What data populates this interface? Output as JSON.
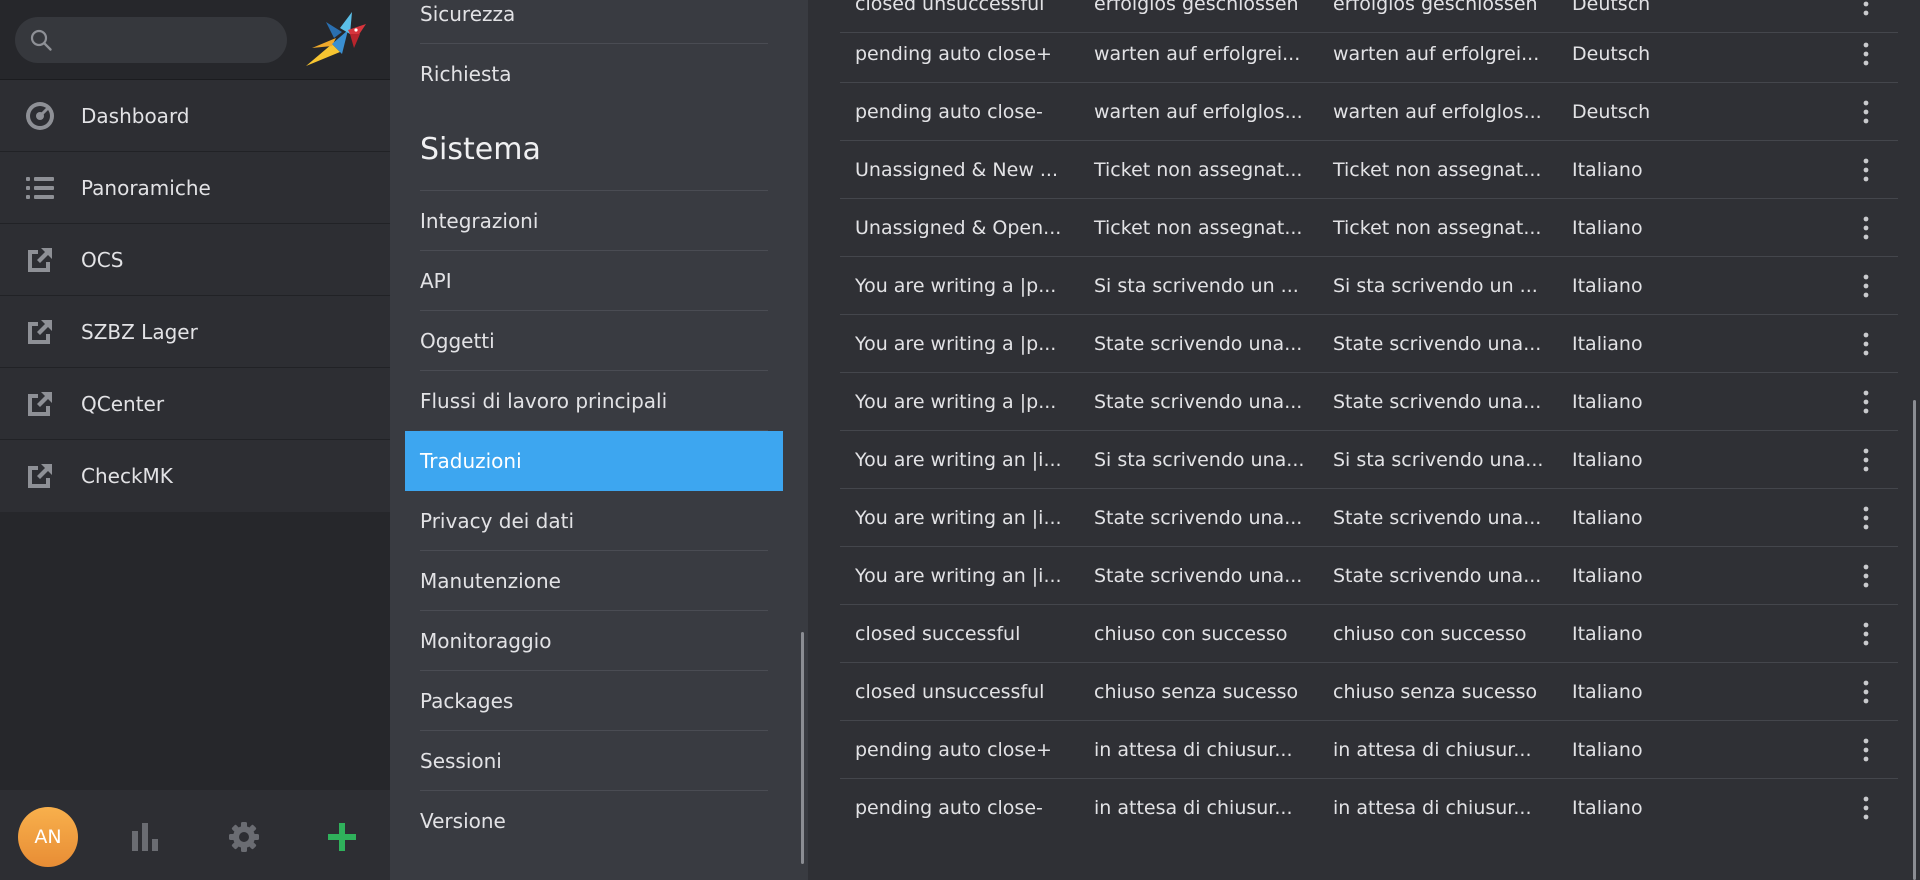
{
  "search": {
    "placeholder": ""
  },
  "nav": {
    "items": [
      {
        "label": "Dashboard",
        "icon": "dashboard-gauge-icon"
      },
      {
        "label": "Panoramiche",
        "icon": "list-icon"
      },
      {
        "label": "OCS",
        "icon": "external-link-icon"
      },
      {
        "label": "SZBZ Lager",
        "icon": "external-link-icon"
      },
      {
        "label": "QCenter",
        "icon": "external-link-icon"
      },
      {
        "label": "CheckMK",
        "icon": "external-link-icon"
      }
    ],
    "footer": {
      "avatar_initials": "AN",
      "stats_icon": "bar-chart-icon",
      "settings_icon": "gear-icon",
      "new_icon": "plus-icon",
      "new_color": "#2fb15b"
    }
  },
  "settings_menu": {
    "top_items": [
      "Sicurezza",
      "Richiesta"
    ],
    "section_title": "Sistema",
    "items": [
      {
        "label": "Integrazioni",
        "active": false
      },
      {
        "label": "API",
        "active": false
      },
      {
        "label": "Oggetti",
        "active": false
      },
      {
        "label": "Flussi di lavoro principali",
        "active": false
      },
      {
        "label": "Traduzioni",
        "active": true
      },
      {
        "label": "Privacy dei dati",
        "active": false
      },
      {
        "label": "Manutenzione",
        "active": false
      },
      {
        "label": "Monitoraggio",
        "active": false
      },
      {
        "label": "Packages",
        "active": false
      },
      {
        "label": "Sessioni",
        "active": false
      },
      {
        "label": "Versione",
        "active": false
      }
    ],
    "accent_color": "#3da6f0"
  },
  "translations": {
    "rows": [
      [
        "closed unsuccessful",
        "erfolglos geschlossen",
        "erfolglos geschlossen",
        "Deutsch"
      ],
      [
        "pending auto close+",
        "warten auf erfolgrei...",
        "warten auf erfolgrei...",
        "Deutsch"
      ],
      [
        "pending auto close-",
        "warten auf erfolglos...",
        "warten auf erfolglos...",
        "Deutsch"
      ],
      [
        "Unassigned & New ...",
        "Ticket non assegnat...",
        "Ticket non assegnat...",
        "Italiano"
      ],
      [
        "Unassigned & Open...",
        "Ticket non assegnat...",
        "Ticket non assegnat...",
        "Italiano"
      ],
      [
        "You are writing a |p...",
        "Si sta scrivendo un ...",
        "Si sta scrivendo un ...",
        "Italiano"
      ],
      [
        "You are writing a |p...",
        "State scrivendo una...",
        "State scrivendo una...",
        "Italiano"
      ],
      [
        "You are writing a |p...",
        "State scrivendo una...",
        "State scrivendo una...",
        "Italiano"
      ],
      [
        "You are writing an |i...",
        "Si sta scrivendo una...",
        "Si sta scrivendo una...",
        "Italiano"
      ],
      [
        "You are writing an |i...",
        "State scrivendo una...",
        "State scrivendo una...",
        "Italiano"
      ],
      [
        "You are writing an |i...",
        "State scrivendo una...",
        "State scrivendo una...",
        "Italiano"
      ],
      [
        "closed successful",
        "chiuso con successo",
        "chiuso con successo",
        "Italiano"
      ],
      [
        "closed unsuccessful",
        "chiuso senza sucesso",
        "chiuso senza sucesso",
        "Italiano"
      ],
      [
        "pending auto close+",
        "in attesa di chiusur...",
        "in attesa di chiusur...",
        "Italiano"
      ],
      [
        "pending auto close-",
        "in attesa di chiusur...",
        "in attesa di chiusur...",
        "Italiano"
      ]
    ],
    "row_action_icon": "more-vertical-icon"
  }
}
